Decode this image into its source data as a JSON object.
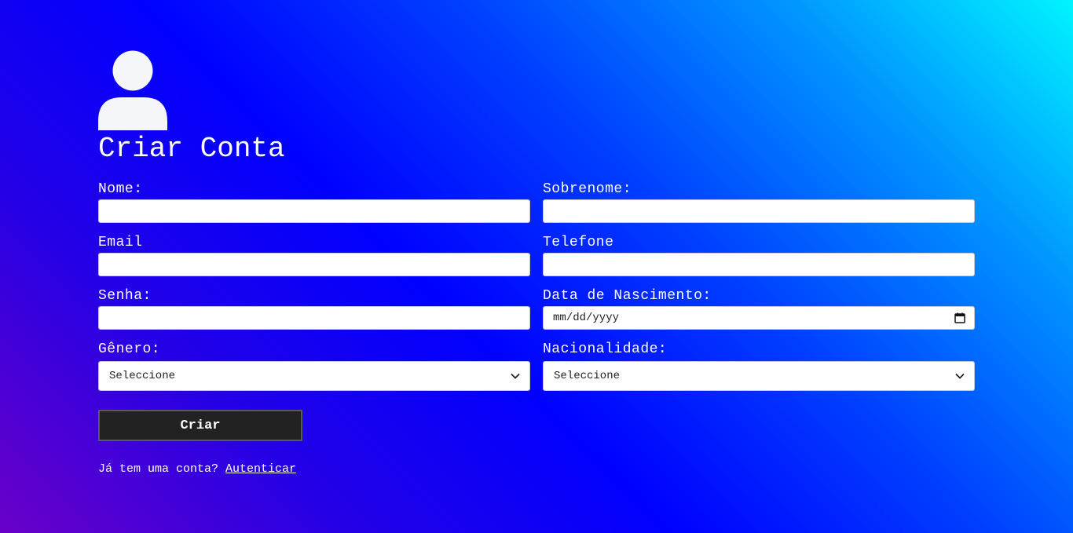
{
  "form": {
    "title": "Criar Conta",
    "fields": {
      "nome": {
        "label": "Nome:",
        "value": ""
      },
      "sobrenome": {
        "label": "Sobrenome:",
        "value": ""
      },
      "email": {
        "label": "Email",
        "value": ""
      },
      "telefone": {
        "label": "Telefone",
        "value": ""
      },
      "senha": {
        "label": "Senha:",
        "value": ""
      },
      "nascimento": {
        "label": "Data de Nascimento:",
        "placeholder": "mm/dd/yyyy"
      },
      "genero": {
        "label": "Gênero:",
        "selected": "Seleccione"
      },
      "nacionalidade": {
        "label": "Nacionalidade:",
        "selected": "Seleccione"
      }
    },
    "submit_label": "Criar",
    "footer": {
      "text": "Já tem uma conta?",
      "link": "Autenticar"
    }
  },
  "icons": {
    "avatar": "user-icon",
    "date": "calendar-icon",
    "select": "chevron-down-icon"
  },
  "colors": {
    "gradient_start": "#6a00c8",
    "gradient_mid": "#0000ff",
    "gradient_end": "#00f5ff",
    "button_bg": "#222222",
    "input_bg": "#ffffff"
  }
}
